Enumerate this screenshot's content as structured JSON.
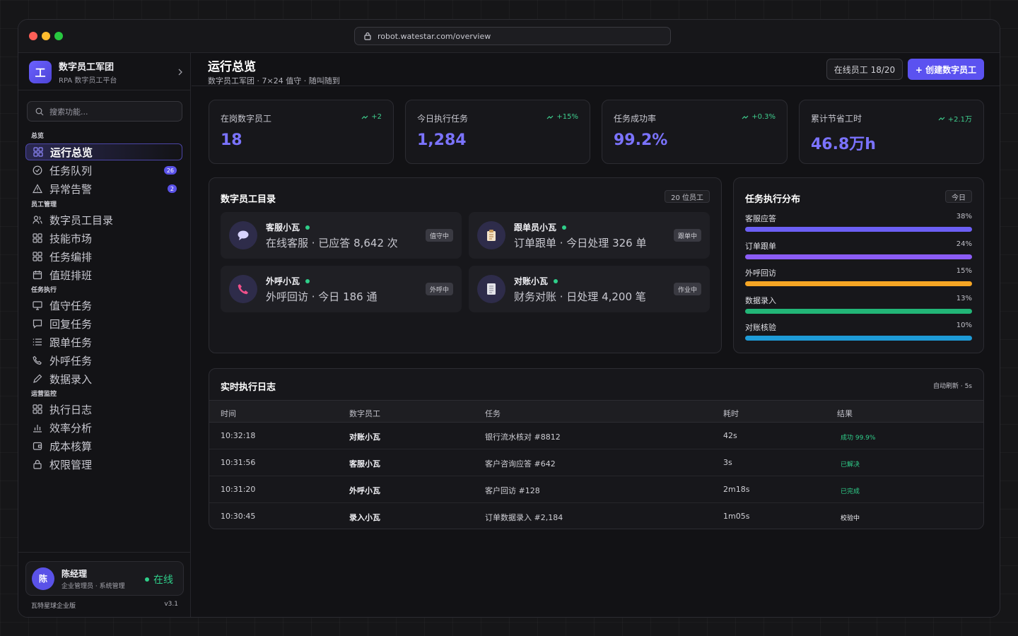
{
  "browser": {
    "url": "robot.watestar.com/overview"
  },
  "brand": {
    "logo": "工",
    "name": "数字员工军团",
    "subtitle": "RPA 数字员工平台"
  },
  "search": {
    "placeholder": "搜索功能..."
  },
  "sidebar": {
    "sections": {
      "overview": "总览",
      "staff": "员工管理",
      "tasks": "任务执行",
      "ops": "运营监控"
    },
    "items": [
      {
        "label": "运行总览",
        "icon": "grid-icon",
        "active": true
      },
      {
        "label": "任务队列",
        "icon": "check-circle-icon",
        "badge": "26"
      },
      {
        "label": "异常告警",
        "icon": "warning-icon",
        "badge": "2"
      },
      {
        "label": "数字员工目录",
        "icon": "users-icon"
      },
      {
        "label": "技能市场",
        "icon": "grid-icon"
      },
      {
        "label": "任务编排",
        "icon": "grid-icon"
      },
      {
        "label": "值班排班",
        "icon": "calendar-icon"
      },
      {
        "label": "值守任务",
        "icon": "monitor-icon"
      },
      {
        "label": "回复任务",
        "icon": "chat-icon"
      },
      {
        "label": "跟单任务",
        "icon": "list-icon"
      },
      {
        "label": "外呼任务",
        "icon": "phone-icon"
      },
      {
        "label": "数据录入",
        "icon": "pen-icon"
      },
      {
        "label": "执行日志",
        "icon": "grid-icon"
      },
      {
        "label": "效率分析",
        "icon": "bar-chart-icon"
      },
      {
        "label": "成本核算",
        "icon": "wallet-icon"
      },
      {
        "label": "权限管理",
        "icon": "lock-icon"
      }
    ]
  },
  "user": {
    "avatar": "陈",
    "name": "陈经理",
    "role": "企业管理员 · 系统管理",
    "status": "在线"
  },
  "footer": {
    "edition": "瓦特星球企业版",
    "version": "v3.1"
  },
  "header": {
    "title": "运行总览",
    "subtitle": "数字员工军团 · 7×24 值守 · 随叫随到",
    "online_pill": "在线员工 18/20",
    "create_button": "+ 创建数字员工"
  },
  "kpis": [
    {
      "label": "在岗数字员工",
      "value": "18",
      "delta": "+2"
    },
    {
      "label": "今日执行任务",
      "value": "1,284",
      "delta": "+15%"
    },
    {
      "label": "任务成功率",
      "value": "99.2%",
      "delta": "+0.3%"
    },
    {
      "label": "累计节省工时",
      "value": "46.8万h",
      "delta": "+2.1万"
    }
  ],
  "directory": {
    "title": "数字员工目录",
    "tag": "20 位员工",
    "employees": [
      {
        "name": "客服小瓦",
        "desc": "在线客服 · 已应答 8,642 次",
        "status": "值守中",
        "icon": "chat-bubble-icon"
      },
      {
        "name": "跟单员小瓦",
        "desc": "订单跟单 · 今日处理 326 单",
        "status": "跟单中",
        "icon": "clipboard-icon"
      },
      {
        "name": "外呼小瓦",
        "desc": "外呼回访 · 今日 186 通",
        "status": "外呼中",
        "icon": "phone-icon"
      },
      {
        "name": "对账小瓦",
        "desc": "财务对账 · 日处理 4,200 笔",
        "status": "作业中",
        "icon": "document-icon"
      }
    ]
  },
  "distribution": {
    "title": "任务执行分布",
    "tag": "今日",
    "items": [
      {
        "label": "客服应答",
        "percent": "38%",
        "fill": 1.0,
        "color": "#6c5ff5"
      },
      {
        "label": "订单跟单",
        "percent": "24%",
        "fill": 1.0,
        "color": "#8b5cf6"
      },
      {
        "label": "外呼回访",
        "percent": "15%",
        "fill": 1.0,
        "color": "#f5a524"
      },
      {
        "label": "数据录入",
        "percent": "13%",
        "fill": 1.0,
        "color": "#22b577"
      },
      {
        "label": "对账核验",
        "percent": "10%",
        "fill": 1.0,
        "color": "#1e9bd7"
      }
    ]
  },
  "log": {
    "title": "实时执行日志",
    "refresh": "自动刷新 · 5s",
    "columns": [
      "时间",
      "数字员工",
      "任务",
      "耗时",
      "结果"
    ],
    "rows": [
      {
        "time": "10:32:18",
        "employee": "对账小瓦",
        "task": "银行流水核对 #8812",
        "duration": "42s",
        "result": "成功 99.9%",
        "result_color": "#2fcf8a"
      },
      {
        "time": "10:31:56",
        "employee": "客服小瓦",
        "task": "客户咨询应答 #642",
        "duration": "3s",
        "result": "已解决",
        "result_color": "#2fcf8a"
      },
      {
        "time": "10:31:20",
        "employee": "外呼小瓦",
        "task": "客户回访 #128",
        "duration": "2m18s",
        "result": "已完成",
        "result_color": "#2fcf8a"
      },
      {
        "time": "10:30:45",
        "employee": "录入小瓦",
        "task": "订单数据录入 #2,184",
        "duration": "1m05s",
        "result": "校验中",
        "result_color": "#f0f0f4"
      }
    ]
  },
  "colors": {
    "accent": "#5b52f0",
    "success": "#2fcf8a"
  }
}
